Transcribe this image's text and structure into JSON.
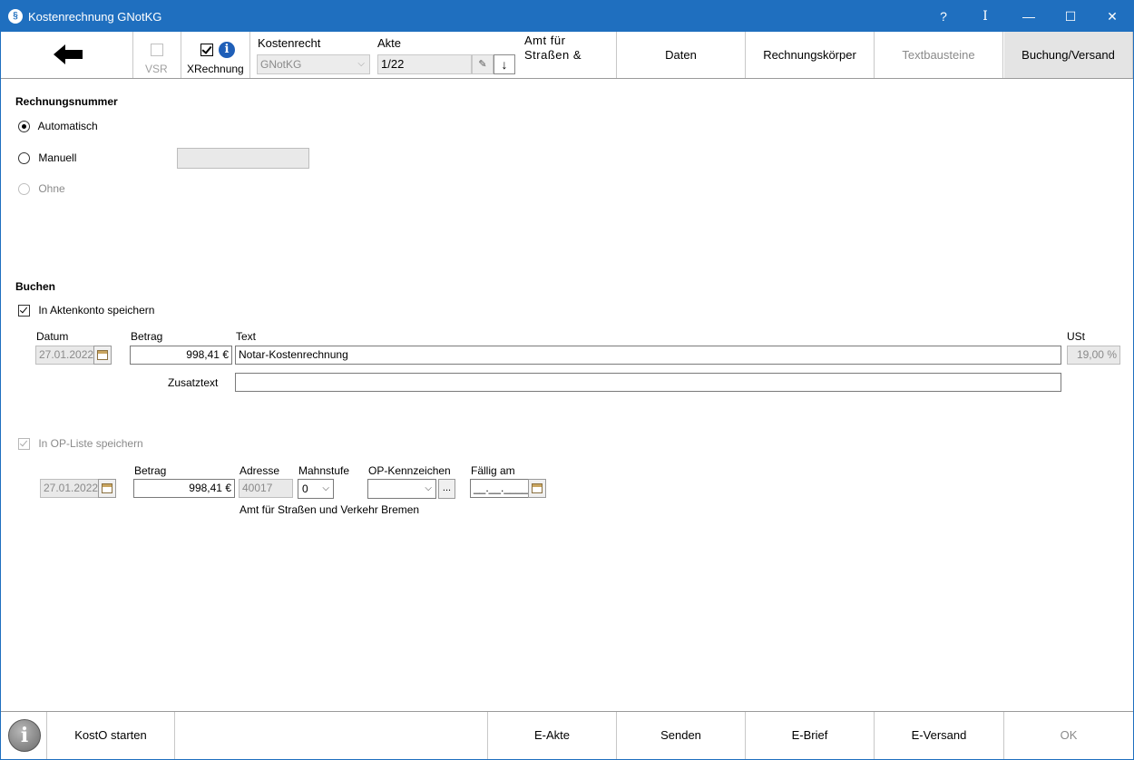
{
  "window": {
    "title": "Kostenrechnung GNotKG",
    "controls": {
      "help": "?",
      "pin": "I",
      "minimize": "—",
      "maximize": "☐",
      "close": "✕"
    }
  },
  "toolbar": {
    "vsr_label": "VSR",
    "xrechnung_label": "XRechnung",
    "kostenrecht_label": "Kostenrecht",
    "kostenrecht_value": "GNotKG",
    "akte_label": "Akte",
    "akte_value": "1/22",
    "amt_text": "Amt für Straßen &",
    "tabs": [
      {
        "label": "Daten"
      },
      {
        "label": "Rechnungskörper"
      },
      {
        "label": "Textbausteine"
      },
      {
        "label": "Buchung/Versand"
      }
    ]
  },
  "rechnungsnummer": {
    "heading": "Rechnungsnummer",
    "option_auto": "Automatisch",
    "option_manual": "Manuell",
    "option_none": "Ohne"
  },
  "buchen": {
    "heading": "Buchen",
    "aktenkonto_label": "In Aktenkonto speichern",
    "datum_label": "Datum",
    "datum_value": "27.01.2022",
    "betrag_label": "Betrag",
    "betrag_value": "998,41 €",
    "text_label": "Text",
    "text_value": "Notar-Kostenrechnung",
    "ust_label": "USt",
    "ust_value": "19,00 %",
    "zusatztext_label": "Zusatztext",
    "zusatztext_value": ""
  },
  "op": {
    "op_liste_label": "In OP-Liste speichern",
    "datum_value": "27.01.2022",
    "betrag_label": "Betrag",
    "betrag_value": "998,41 €",
    "adresse_label": "Adresse",
    "adresse_value": "40017",
    "mahnstufe_label": "Mahnstufe",
    "mahnstufe_value": "0",
    "kennzeichen_label": "OP-Kennzeichen",
    "kennzeichen_value": "",
    "browse_label": "...",
    "faellig_label": "Fällig am",
    "faellig_value": "__.__.____",
    "adresse_name": "Amt für Straßen und Verkehr Bremen"
  },
  "bottom": {
    "kosto_label": "KostO starten",
    "eakte_label": "E-Akte",
    "senden_label": "Senden",
    "ebrief_label": "E-Brief",
    "eversand_label": "E-Versand",
    "ok_label": "OK"
  },
  "colors": {
    "titlebar": "#1f6fbf",
    "info_blue": "#1f5fb8"
  },
  "icons": [
    "app-icon",
    "back-arrow-icon",
    "info-icon",
    "pin-icon",
    "download-arrow-icon",
    "calendar-icon",
    "chevron-down-icon",
    "info-circle-icon"
  ]
}
